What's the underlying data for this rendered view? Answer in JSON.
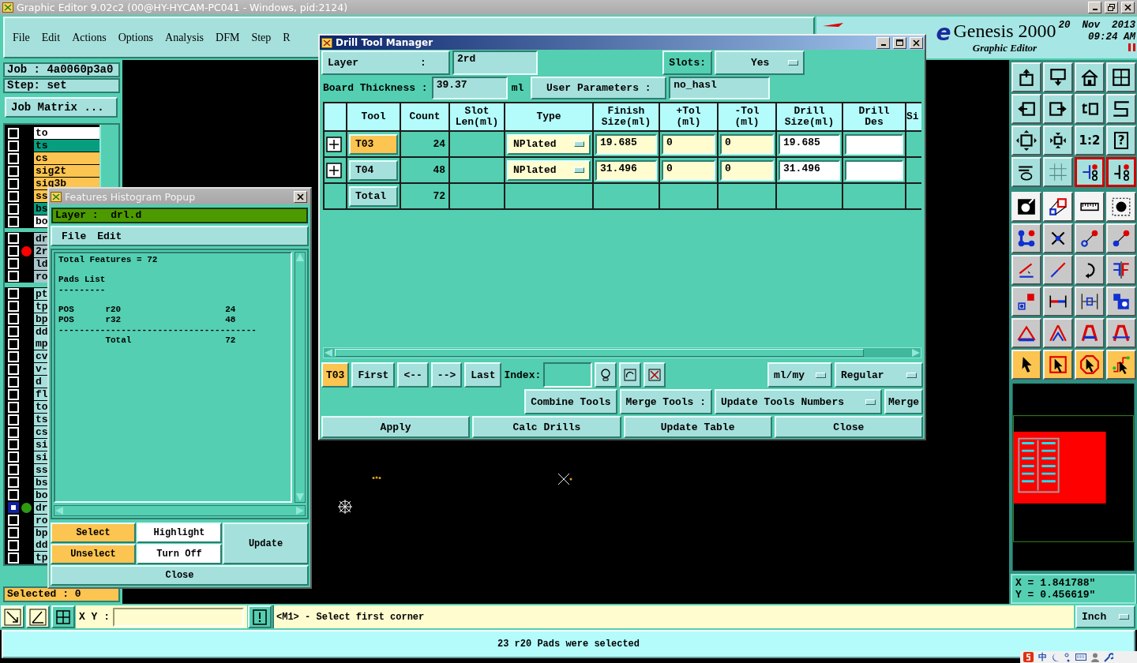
{
  "window": {
    "title": "Graphic Editor 9.02c2 (00@HY-HYCAM-PC041 - Windows, pid:2124)"
  },
  "menu": [
    "File",
    "Edit",
    "Actions",
    "Options",
    "Analysis",
    "DFM",
    "Step",
    "R"
  ],
  "brand": {
    "logo_fragment": "e",
    "product": "Genesis 2000",
    "subtitle": "Graphic Editor",
    "date": "20  Nov  2013",
    "time": "09:24 AM"
  },
  "job": {
    "job": "Job : 4a0060p3a0",
    "step": "Step: set",
    "matrix_button": "Job Matrix ..."
  },
  "layer_groups": [
    {
      "layers": [
        {
          "name": "to",
          "color": "#ffffff",
          "selected": false
        },
        {
          "name": "ts",
          "color": "#079e80",
          "selected": false
        },
        {
          "name": "cs",
          "color": "#fcc450",
          "selected": false
        },
        {
          "name": "sig2t",
          "color": "#fcc450",
          "selected": false
        },
        {
          "name": "sig3b",
          "color": "#fcc450",
          "selected": false
        },
        {
          "name": "ss",
          "color": "#fcc450",
          "selected": false
        },
        {
          "name": "bs",
          "color": "#079e80",
          "selected": false
        },
        {
          "name": "bo",
          "color": "#ffffff",
          "selected": false
        }
      ]
    },
    {
      "layers": [
        {
          "name": "dr",
          "color": "#a9c6cc",
          "selected": false
        },
        {
          "name": "2r",
          "color": "#a9c6cc",
          "selected": false,
          "marker": {
            "color": "#ff0000"
          }
        },
        {
          "name": "ld",
          "color": "#a9c6cc",
          "selected": false
        },
        {
          "name": "ro",
          "color": "#a9c6cc",
          "selected": false
        }
      ]
    },
    {
      "layers": [
        {
          "name": "pt",
          "color": "#a6e0dc",
          "selected": false
        },
        {
          "name": "tp",
          "color": "#a6e0dc",
          "selected": false
        },
        {
          "name": "bp",
          "color": "#a6e0dc",
          "selected": false
        },
        {
          "name": "dd",
          "color": "#a6e0dc",
          "selected": false
        },
        {
          "name": "mp",
          "color": "#a6e0dc",
          "selected": false
        },
        {
          "name": "cv",
          "color": "#a6e0dc",
          "selected": false
        },
        {
          "name": "v-",
          "color": "#a6e0dc",
          "selected": false
        },
        {
          "name": "d",
          "color": "#a6e0dc",
          "selected": false
        },
        {
          "name": "fl",
          "color": "#a6e0dc",
          "selected": false
        },
        {
          "name": "to",
          "color": "#a6e0dc",
          "selected": false
        },
        {
          "name": "ts",
          "color": "#a6e0dc",
          "selected": false
        },
        {
          "name": "cs",
          "color": "#a6e0dc",
          "selected": false
        },
        {
          "name": "si",
          "color": "#a6e0dc",
          "selected": false
        },
        {
          "name": "si",
          "color": "#a6e0dc",
          "selected": false
        },
        {
          "name": "ss",
          "color": "#a6e0dc",
          "selected": false
        },
        {
          "name": "bs",
          "color": "#a6e0dc",
          "selected": false
        },
        {
          "name": "bo",
          "color": "#a6e0dc",
          "selected": false
        },
        {
          "name": "dr",
          "color": "#a6e0dc",
          "selected": true,
          "marker": {
            "color": "#2e9a10"
          }
        },
        {
          "name": "ro",
          "color": "#a6e0dc",
          "selected": false
        },
        {
          "name": "bp",
          "color": "#a6e0dc",
          "selected": false
        },
        {
          "name": "dd",
          "color": "#a6e0dc",
          "selected": false
        },
        {
          "name": "tp",
          "color": "#a6e0dc",
          "selected": false
        }
      ]
    }
  ],
  "selected_count": "Selected : 0",
  "histogram": {
    "title": "Features Histogram Popup",
    "layer": "Layer :  drl.d",
    "menu": [
      "File",
      "Edit"
    ],
    "report_blocks": [
      [
        "Total Features = 72"
      ],
      [
        "Pads List",
        "---------"
      ],
      [
        "POS      r20                    24",
        "POS      r32                    48",
        "--------------------------------------",
        "         Total                  72"
      ]
    ],
    "buttons": [
      {
        "label": "Select",
        "color": "#fcc450"
      },
      {
        "label": "Highlight",
        "color": "#ffffff"
      },
      {
        "label": "Update",
        "color": "#a6e0dc"
      },
      {
        "label": "Unselect",
        "color": "#fcc450"
      },
      {
        "label": "Turn Off",
        "color": "#ffffff"
      },
      {
        "label": "Close",
        "color": "#a6e0dc"
      }
    ]
  },
  "drill_tool_manager": {
    "title": "Drill Tool Manager",
    "layer_label": "Layer          :",
    "layer": "2rd",
    "slots_label": "Slots:",
    "slots": "Yes",
    "thickness_label": "Board Thickness :",
    "thickness": "39.37",
    "thickness_unit": "ml",
    "user_params_button": "User Parameters :",
    "user_params": "no_hasl",
    "columns": [
      "Tool",
      "Count",
      "Slot\nLen(ml)",
      "Type",
      "Finish\nSize(ml)",
      "+Tol\n(ml)",
      "-Tol\n(ml)",
      "Drill\nSize(ml)",
      "Drill\nDes",
      "Si"
    ],
    "rows": [
      {
        "tool": "T03",
        "selected": true,
        "expanded": false,
        "count": "24",
        "type": "NPlated",
        "finish": "19.685",
        "plus_tol": "0",
        "minus_tol": "0",
        "drill_size": "19.685"
      },
      {
        "tool": "T04",
        "selected": false,
        "expanded": false,
        "count": "48",
        "type": "NPlated",
        "finish": "31.496",
        "plus_tol": "0",
        "minus_tol": "0",
        "drill_size": "31.496"
      }
    ],
    "total": {
      "label": "Total",
      "count": "72"
    },
    "nav": {
      "current": "T03",
      "first": "First",
      "prev": "<--",
      "next": "-->",
      "last": "Last",
      "index_label": "Index:",
      "units": "ml/my",
      "mode": "Regular"
    },
    "merge": {
      "combine": "Combine Tools",
      "merge_label": "Merge Tools :",
      "merge_mode": "Update Tools Numbers",
      "merge": "Merge"
    },
    "actions": [
      "Apply",
      "Calc Drills",
      "Update Table",
      "Close"
    ]
  },
  "toolbar_groups": [
    {
      "buttons": [
        {
          "selected": false
        },
        {
          "selected": false
        },
        {
          "selected": false
        },
        {
          "selected": false
        },
        {
          "selected": false
        },
        {
          "selected": false
        },
        {
          "selected": false
        },
        {
          "selected": false
        },
        {
          "selected": false
        },
        {
          "selected": false
        },
        {
          "label": "1:2",
          "selected": false
        },
        {
          "label": "?",
          "selected": false
        },
        {
          "selected": false
        },
        {
          "selected": false
        },
        {
          "selected": true
        },
        {
          "selected": true
        }
      ]
    },
    {
      "buttons": [
        {
          "selected": false
        },
        {
          "selected": false
        },
        {
          "selected": false
        },
        {
          "selected": false
        },
        {
          "selected": false
        },
        {
          "selected": false
        },
        {
          "selected": false
        },
        {
          "selected": false
        },
        {
          "selected": false
        },
        {
          "selected": false
        },
        {
          "selected": false
        },
        {
          "selected": false
        },
        {
          "selected": false
        },
        {
          "selected": false
        },
        {
          "selected": false
        },
        {
          "selected": false
        },
        {
          "selected": false
        },
        {
          "selected": false
        },
        {
          "selected": false
        },
        {
          "selected": false
        },
        {
          "selected": false
        },
        {
          "selected": false
        },
        {
          "selected": false
        },
        {
          "selected": false
        }
      ]
    }
  ],
  "coords": {
    "x": "X = 1.841788\"",
    "y": "Y = 0.456619\""
  },
  "bottom_bar": {
    "xy_label": "X Y :",
    "prompt": "<M1> - Select first corner",
    "units": "Inch"
  },
  "status": "23 r20 Pads were selected",
  "tray": {
    "ime": "中"
  }
}
